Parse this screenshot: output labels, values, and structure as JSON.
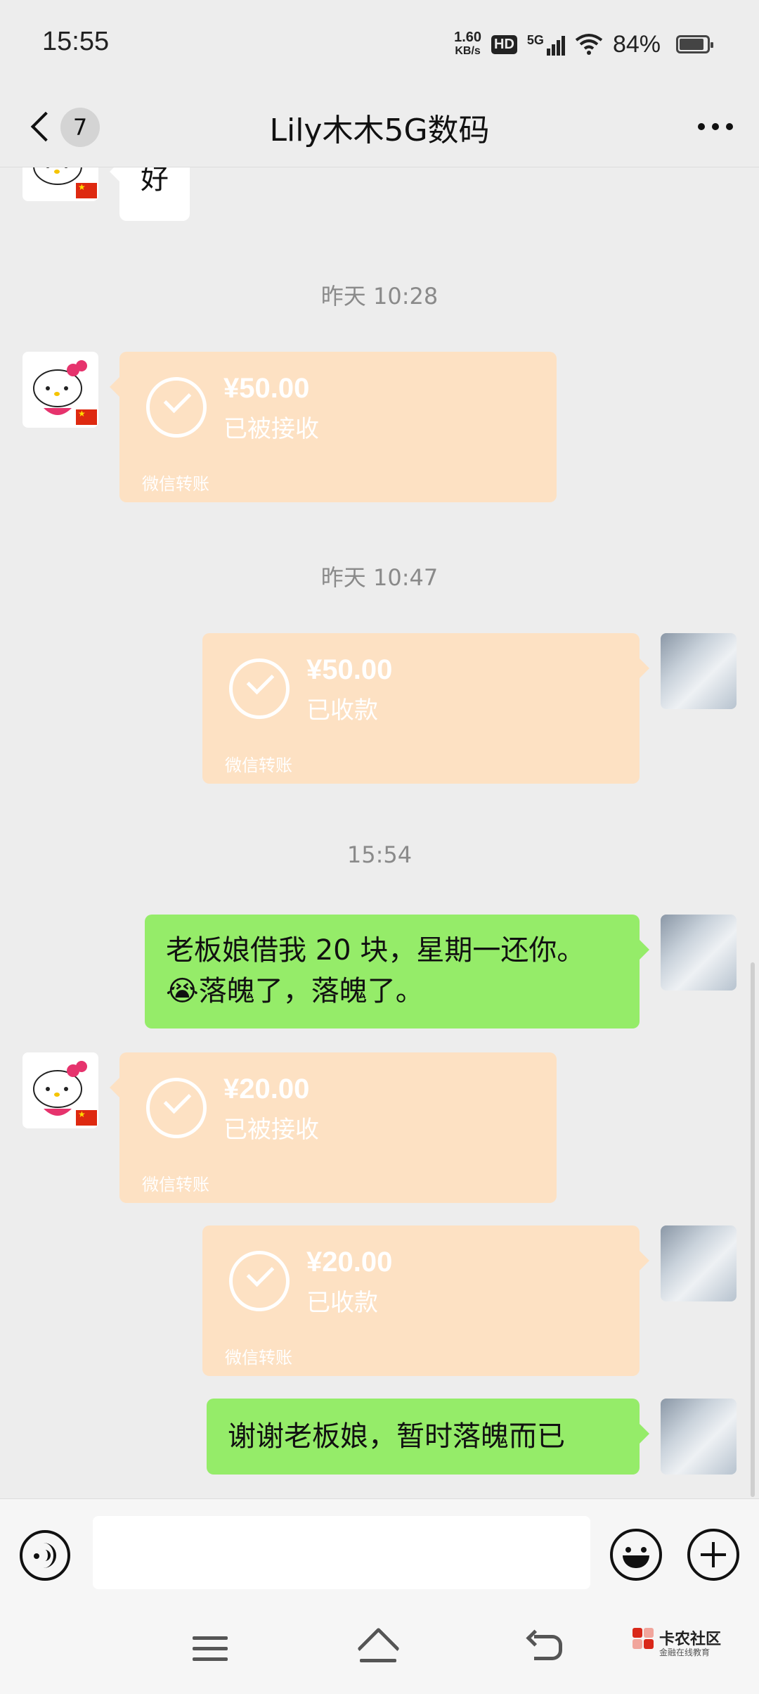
{
  "status_bar": {
    "time": "15:55",
    "net_speed_value": "1.60",
    "net_speed_unit": "KB/s",
    "hd_badge": "HD",
    "network_type": "5G",
    "battery_percent": "84%",
    "battery_level": 0.84,
    "icons": [
      "hd-icon",
      "signal-5g-icon",
      "wifi-icon",
      "battery-icon"
    ]
  },
  "header": {
    "back_count": "7",
    "title": "Lily木木5G数码",
    "icons": [
      "back-chevron-icon",
      "more-icon"
    ]
  },
  "messages": [
    {
      "type": "text",
      "sender": "contact",
      "text": "好"
    },
    {
      "type": "timestamp",
      "text": "昨天 10:28"
    },
    {
      "type": "transfer",
      "sender": "contact",
      "amount": "¥50.00",
      "status": "已被接收",
      "brand": "微信转账"
    },
    {
      "type": "timestamp",
      "text": "昨天 10:47"
    },
    {
      "type": "transfer",
      "sender": "me",
      "amount": "¥50.00",
      "status": "已收款",
      "brand": "微信转账"
    },
    {
      "type": "timestamp",
      "text": "15:54"
    },
    {
      "type": "text",
      "sender": "me",
      "line1": "老板娘借我 20 块，星期一还你。",
      "line2": "😭落魄了，落魄了。"
    },
    {
      "type": "transfer",
      "sender": "contact",
      "amount": "¥20.00",
      "status": "已被接收",
      "brand": "微信转账"
    },
    {
      "type": "transfer",
      "sender": "me",
      "amount": "¥20.00",
      "status": "已收款",
      "brand": "微信转账"
    },
    {
      "type": "text",
      "sender": "me",
      "text": "谢谢老板娘，暂时落魄而已"
    }
  ],
  "input_bar": {
    "value": "",
    "placeholder": "",
    "icons": [
      "voice-icon",
      "emoji-icon",
      "plus-icon"
    ]
  },
  "system_nav": {
    "icons": [
      "menu-icon",
      "home-icon",
      "back-icon"
    ]
  },
  "watermark": {
    "title": "卡农社区",
    "subtitle": "金融在线教育"
  },
  "colors": {
    "background": "#ededed",
    "my_bubble": "#95ec69",
    "contact_bubble": "#ffffff",
    "transfer_card": "#fde1c3",
    "timestamp_text": "#8a8a8a",
    "watermark_red": "#d9281a"
  }
}
